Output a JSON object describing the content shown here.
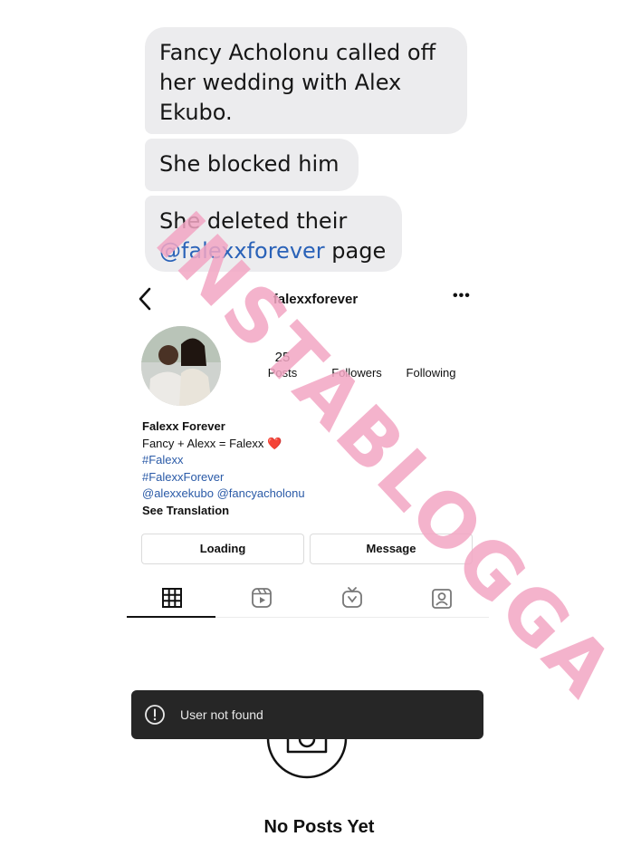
{
  "chat": {
    "messages": [
      {
        "text_before": "Fancy Acholonu called off her wedding with Alex Ekubo.",
        "mention": "",
        "text_after": ""
      },
      {
        "text_before": "She blocked him",
        "mention": "",
        "text_after": ""
      },
      {
        "text_before": "She deleted their ",
        "mention": "@falexxforever",
        "text_after": " page"
      }
    ]
  },
  "profile": {
    "username": "falexxforever",
    "stats": {
      "posts_count": "25",
      "posts_label": "Posts",
      "followers_label": "Followers",
      "following_label": "Following"
    },
    "bio": {
      "name": "Falexx Forever",
      "line1": "Fancy + Alexx = Falexx ❤️",
      "hashtag1": "#Falexx",
      "hashtag2": "#FalexxForever",
      "mentions": "@alexxekubo @fancyacholonu",
      "see_translation": "See Translation"
    },
    "buttons": {
      "loading": "Loading",
      "message": "Message"
    }
  },
  "tabs": [
    {
      "icon": "grid-icon",
      "active": true
    },
    {
      "icon": "reels-icon",
      "active": false
    },
    {
      "icon": "igtv-icon",
      "active": false
    },
    {
      "icon": "tagged-icon",
      "active": false
    }
  ],
  "toast": {
    "icon": "info-icon",
    "text": "User not found"
  },
  "empty_state": {
    "icon": "camera-icon",
    "title": "No Posts Yet"
  },
  "watermark": {
    "text": "INSTABLOGGA",
    "color": "#f2a6c3"
  },
  "colors": {
    "bubble": "#ececee",
    "mention": "#2a62b8",
    "toast_bg": "#262626"
  }
}
